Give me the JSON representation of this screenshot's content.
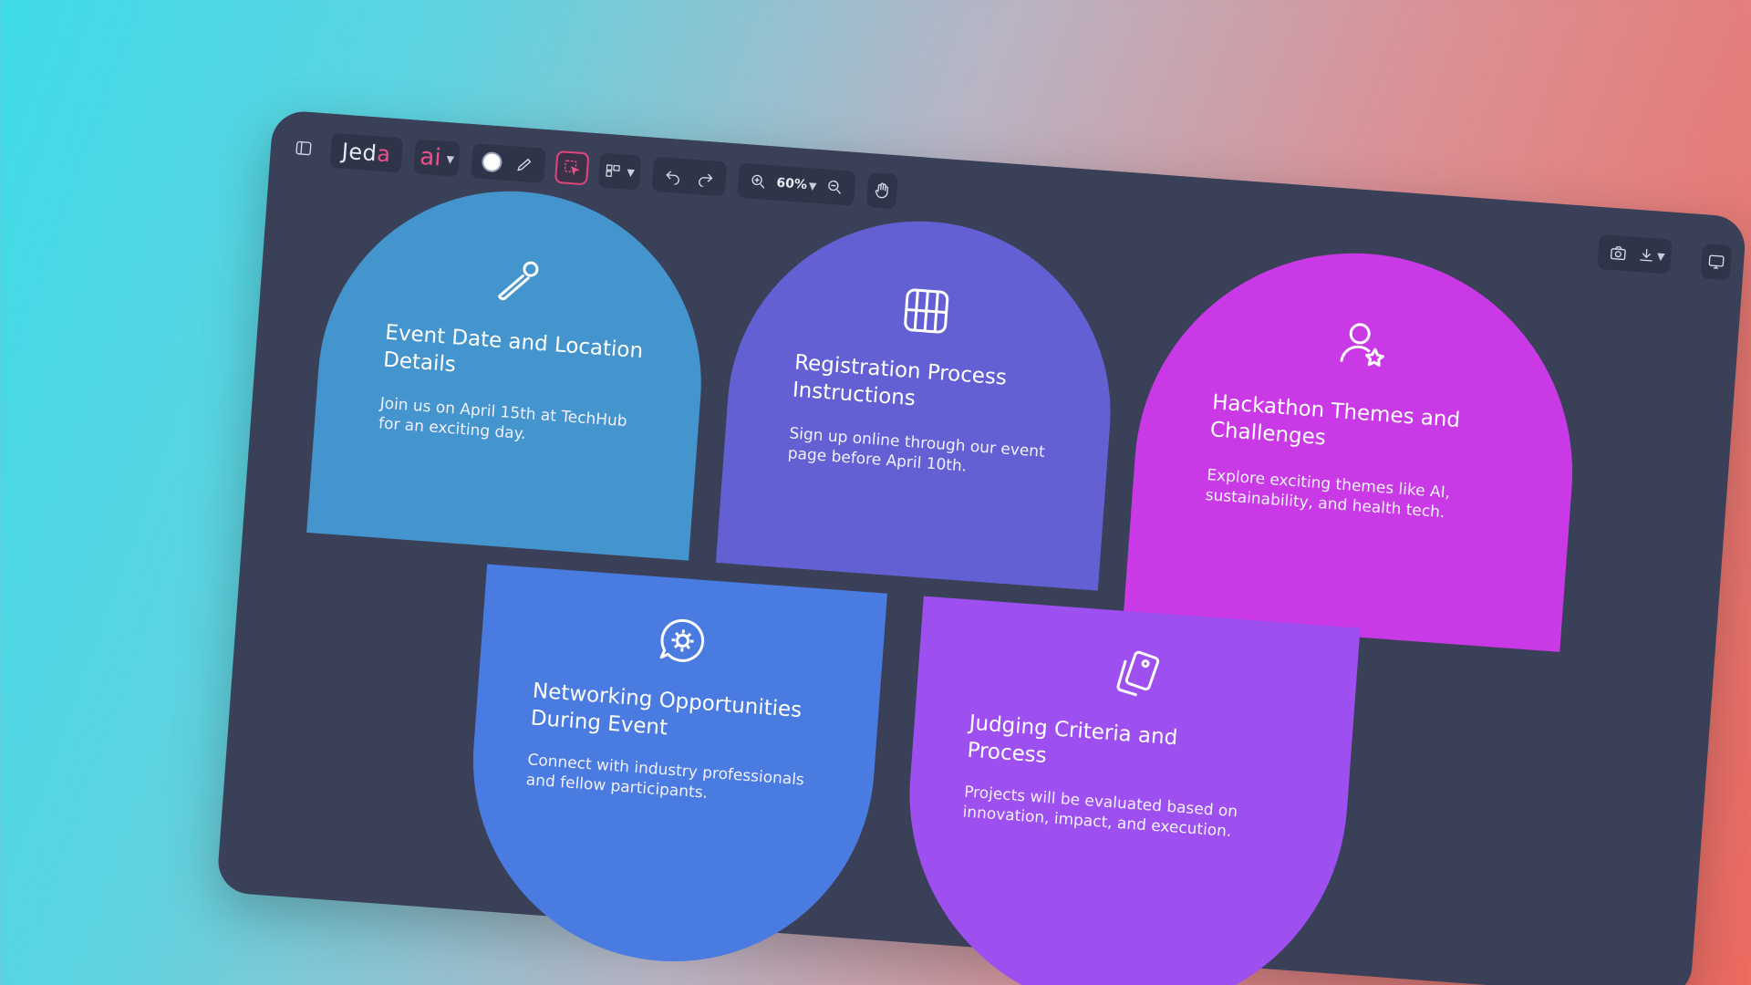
{
  "toolbar": {
    "brand_prefix": "Jed",
    "brand_accent": "a",
    "ai_label": "ai",
    "zoom_level": "60%"
  },
  "cards": [
    {
      "title": "Event Date and Location Details",
      "description": "Join us on April 15th at TechHub for an exciting day.",
      "icon": "safety-pin-icon",
      "color": "#4494ce"
    },
    {
      "title": "Registration Process Instructions",
      "description": "Sign up online through our event page before April 10th.",
      "icon": "layout-grid-icon",
      "color": "#6360d4"
    },
    {
      "title": "Hackathon Themes and Challenges",
      "description": "Explore exciting themes like AI, sustainability, and health tech.",
      "icon": "user-star-icon",
      "color": "#c93ae6"
    },
    {
      "title": "Networking Opportunities During Event",
      "description": "Connect with industry professionals and fellow participants.",
      "icon": "gear-chat-icon",
      "color": "#4a7be0"
    },
    {
      "title": "Judging Criteria and Process",
      "description": "Projects will be evaluated based on innovation, impact, and execution.",
      "icon": "tag-cards-icon",
      "color": "#9e4ff0"
    }
  ]
}
